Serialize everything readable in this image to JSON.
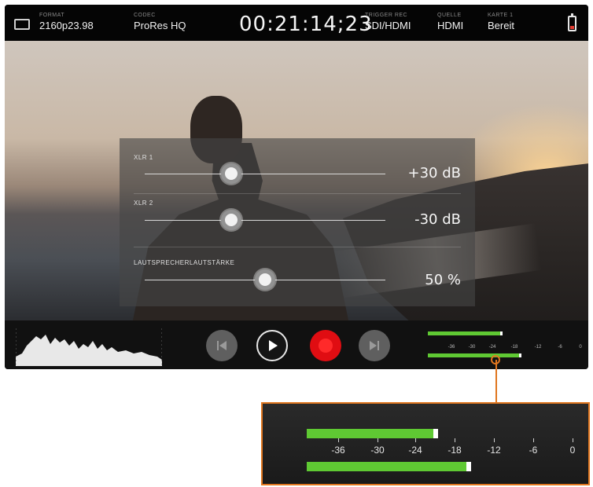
{
  "status_bar": {
    "format_label": "FORMAT",
    "format_value": "2160p23.98",
    "codec_label": "CODEC",
    "codec_value": "ProRes HQ",
    "timecode": "00:21:14;23",
    "trigger_label": "TRIGGER REC",
    "trigger_value": "SDI/HDMI",
    "source_label": "QUELLE",
    "source_value": "HDMI",
    "card_label": "KARTE 1",
    "card_value": "Bereit",
    "battery_level": 0.25,
    "battery_color": "#e03a2f"
  },
  "audio_panel": {
    "channels": [
      {
        "label": "XLR 1",
        "value": "+30 dB",
        "level": 0.36
      },
      {
        "label": "XLR 2",
        "value": "-30 dB",
        "level": 0.36
      },
      {
        "label": "LAUTSPRECHERLAUTSTÄRKE",
        "value": "50 %",
        "level": 0.5
      }
    ]
  },
  "controls": {
    "prev_icon": "skip-back-icon",
    "play_icon": "play-icon",
    "record_icon": "record-icon",
    "next_icon": "skip-forward-icon",
    "record_color": "#e00d12"
  },
  "audio_meter": {
    "ticks": [
      "-36",
      "-30",
      "-24",
      "-18",
      "-12",
      "-6",
      "0"
    ],
    "channel_1_level": 0.46,
    "channel_2_level": 0.58,
    "meter_color": "#5fc933",
    "callout_color": "#e0761f"
  }
}
